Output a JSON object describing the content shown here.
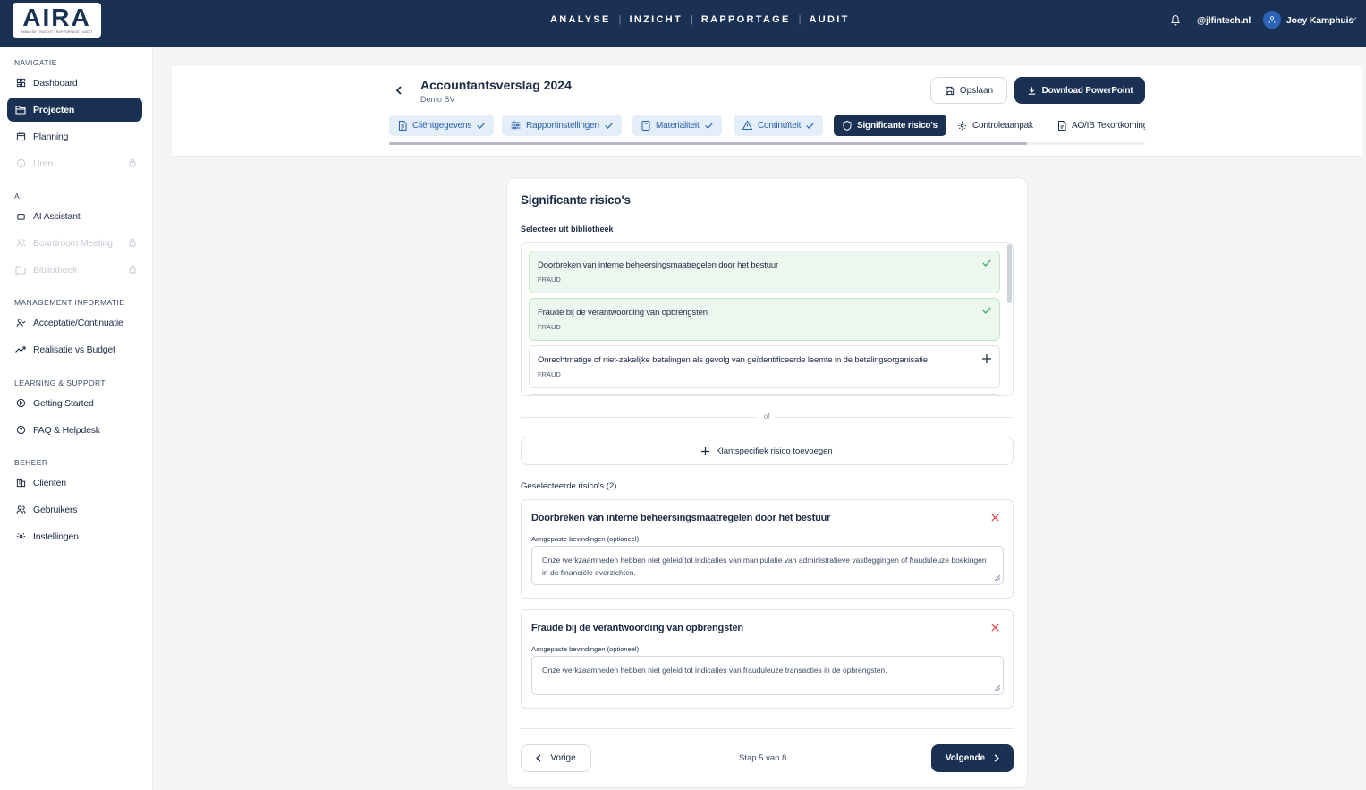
{
  "topbar": {
    "logo_text": "AIRA",
    "logo_subtitle": "ANALYSE | INZICHT | RAPPORTAGE | AUDIT",
    "nav": [
      "ANALYSE",
      "INZICHT",
      "RAPPORTAGE",
      "AUDIT"
    ],
    "separator": "|",
    "email": "@jlfintech.nl",
    "user_name": "Joey Kamphuis",
    "icons": {
      "notifications": "bell-icon",
      "avatar": "user-icon",
      "user_menu": "chevron-down-icon"
    }
  },
  "sidebar": {
    "sections": [
      {
        "title": "NAVIGATIE",
        "items": [
          {
            "label": "Dashboard",
            "icon": "grid-icon",
            "state": "normal"
          },
          {
            "label": "Projecten",
            "icon": "folder-icon",
            "state": "active"
          },
          {
            "label": "Planning",
            "icon": "calendar-icon",
            "state": "normal"
          },
          {
            "label": "Uren",
            "icon": "clock-icon",
            "state": "locked"
          }
        ]
      },
      {
        "title": "AI",
        "items": [
          {
            "label": "AI Assistant",
            "icon": "bot-icon",
            "state": "normal"
          },
          {
            "label": "Boardroom Meeting",
            "icon": "users-icon",
            "state": "locked"
          },
          {
            "label": "Bibliotheek",
            "icon": "folder-icon",
            "state": "locked"
          }
        ]
      },
      {
        "title": "MANAGEMENT INFORMATIE",
        "items": [
          {
            "label": "Acceptatie/Continuatie",
            "icon": "user-check-icon",
            "state": "normal"
          },
          {
            "label": "Realisatie vs Budget",
            "icon": "trend-icon",
            "state": "normal"
          }
        ]
      },
      {
        "title": "LEARNING & SUPPORT",
        "items": [
          {
            "label": "Getting Started",
            "icon": "play-circle-icon",
            "state": "normal"
          },
          {
            "label": "FAQ & Helpdesk",
            "icon": "help-circle-icon",
            "state": "normal"
          }
        ]
      },
      {
        "title": "BEHEER",
        "items": [
          {
            "label": "Cliënten",
            "icon": "building-icon",
            "state": "normal"
          },
          {
            "label": "Gebruikers",
            "icon": "users-icon",
            "state": "normal"
          },
          {
            "label": "Instellingen",
            "icon": "gear-icon",
            "state": "normal"
          }
        ]
      }
    ]
  },
  "header": {
    "title": "Accountantsverslag 2024",
    "subtitle": "Demo BV",
    "save_label": "Opslaan",
    "download_label": "Download PowerPoint",
    "tabs": [
      {
        "label": "Cliëntgegevens",
        "icon": "file-icon",
        "status": "done"
      },
      {
        "label": "Rapportinstellingen",
        "icon": "sliders-icon",
        "status": "done"
      },
      {
        "label": "Materialiteit",
        "icon": "calculator-icon",
        "status": "done"
      },
      {
        "label": "Continuïteit",
        "icon": "warning-icon",
        "status": "done"
      },
      {
        "label": "Significante risico's",
        "icon": "shield-icon",
        "status": "current"
      },
      {
        "label": "Controleaanpak",
        "icon": "gear-icon",
        "status": "todo"
      },
      {
        "label": "AO/IB Tekortkomingen",
        "icon": "file-icon",
        "status": "todo"
      }
    ],
    "tab_scroll_fraction": 0.84
  },
  "main": {
    "title": "Significante risico's",
    "library_label": "Selecteer uit bibliotheek",
    "library_items": [
      {
        "title": "Doorbreken van interne beheersingsmaatregelen door het bestuur",
        "category": "FRAUD",
        "selected": true
      },
      {
        "title": "Fraude bij de verantwoording van opbrengsten",
        "category": "FRAUD",
        "selected": true
      },
      {
        "title": "Onrechtmatige of niet-zakelijke betalingen als gevolg van geïdentificeerde leemte in de betalingsorganisatie",
        "category": "FRAUD",
        "selected": false
      }
    ],
    "or_label": "of",
    "add_custom_label": "Klantspecifiek risico toevoegen",
    "selected_label": "Geselecteerde risico's (2)",
    "findings_label": "Aangepaste bevindingen (optioneel)",
    "selected_risks": [
      {
        "title": "Doorbreken van interne beheersingsmaatregelen door het bestuur",
        "findings": "Onze werkzaamheden hebben niet geleid tot indicaties van manipulatie van administratieve vastleggingen of frauduleuze boekingen in de financiële overzichten."
      },
      {
        "title": "Fraude bij de verantwoording van opbrengsten",
        "findings": "Onze werkzaamheden hebben niet geleid tot indicaties van frauduleuze transacties in de opbrengsten."
      }
    ],
    "prev_label": "Vorige",
    "step_text": "Stap 5 van 8",
    "next_label": "Volgende"
  },
  "colors": {
    "navy": "#1b3153",
    "done_tab": "#e3eef9",
    "selected_item": "#ecf8ef",
    "check": "#3aa65a",
    "remove": "#e04848"
  }
}
